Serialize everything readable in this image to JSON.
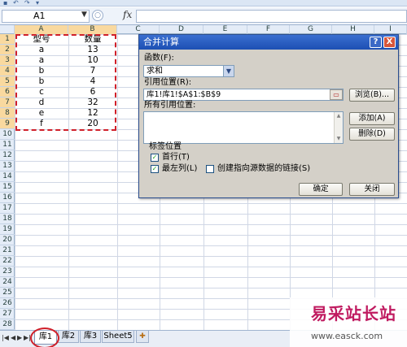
{
  "formula_bar": {
    "cell_ref": "A1",
    "fx_label": "fx"
  },
  "columns": [
    "A",
    "B",
    "C",
    "D",
    "E",
    "F",
    "G",
    "H",
    "I"
  ],
  "rows": [
    "1",
    "2",
    "3",
    "4",
    "5",
    "6",
    "7",
    "8",
    "9",
    "10",
    "11",
    "12",
    "13",
    "14",
    "15",
    "16",
    "17",
    "18",
    "19",
    "20",
    "21",
    "22",
    "23",
    "24",
    "25",
    "26",
    "27",
    "28"
  ],
  "table": {
    "headers": [
      "型号",
      "数量"
    ],
    "data": [
      [
        "a",
        "13"
      ],
      [
        "a",
        "10"
      ],
      [
        "b",
        "7"
      ],
      [
        "b",
        "4"
      ],
      [
        "c",
        "6"
      ],
      [
        "d",
        "32"
      ],
      [
        "e",
        "12"
      ],
      [
        "f",
        "20"
      ]
    ]
  },
  "dialog": {
    "title": "合并计算",
    "help_label": "?",
    "close_label": "X",
    "function_label": "函数(F):",
    "function_value": "求和",
    "ref_label": "引用位置(R):",
    "ref_value": "库1!库1!$A$1:$B$9",
    "browse_label": "浏览(B)...",
    "all_refs_label": "所有引用位置:",
    "add_label": "添加(A)",
    "delete_label": "删除(D)",
    "labels_group": "标签位置",
    "first_row_label": "首行(T)",
    "first_row_checked": true,
    "left_col_label": "最左列(L)",
    "left_col_checked": true,
    "link_label": "创建指向源数据的链接(S)",
    "link_checked": false,
    "ok_label": "确定",
    "cancel_label": "关闭"
  },
  "sheet_tabs": [
    "库1",
    "库2",
    "库3",
    "Sheet5"
  ],
  "active_sheet": "库1",
  "watermark": {
    "title": "易采站长站",
    "url": "www.easck.com"
  }
}
